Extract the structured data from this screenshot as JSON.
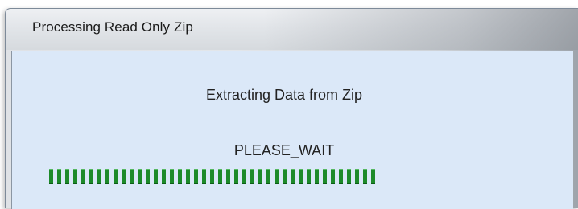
{
  "dialog": {
    "title": "Processing Read Only Zip",
    "message": "Extracting Data from Zip",
    "status": "PLEASE_WAIT"
  },
  "progress": {
    "segments_filled": 41,
    "color": "#1d8a2a"
  }
}
